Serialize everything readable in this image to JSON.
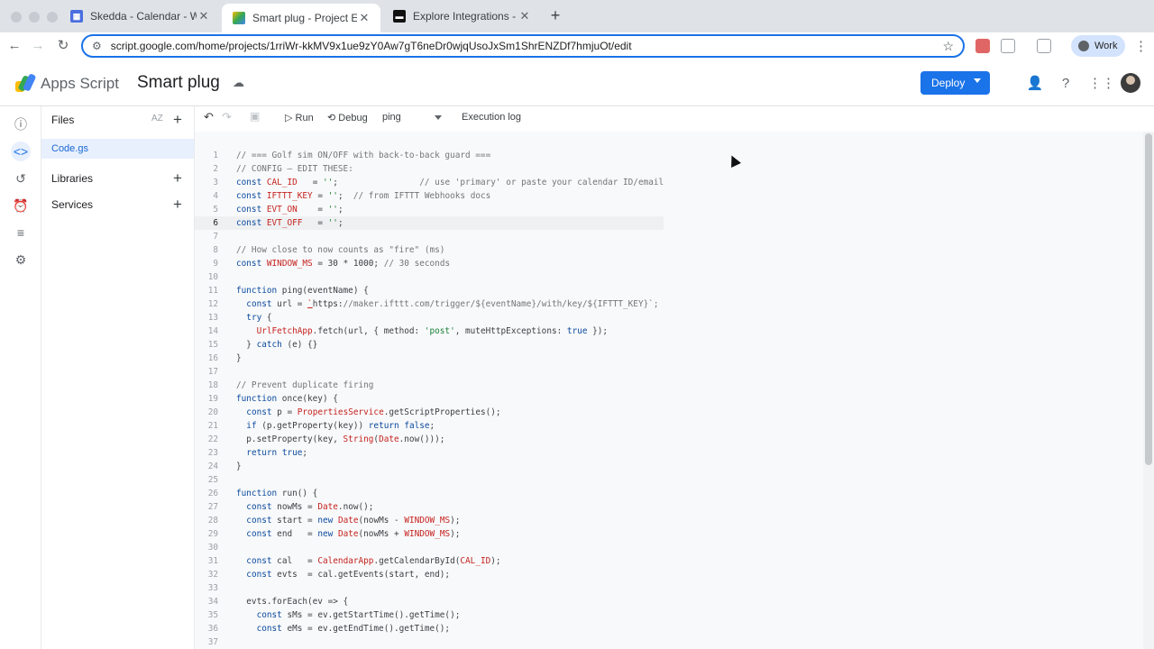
{
  "browser": {
    "tabs": [
      {
        "title": "Skedda - Calendar - Week of",
        "active": false
      },
      {
        "title": "Smart plug - Project Editor -",
        "active": true
      },
      {
        "title": "Explore Integrations - IFTTT",
        "active": false
      }
    ],
    "new_tab": "+",
    "url": "script.google.com/home/projects/1rriWr-kkMV9x1ue9zY0Aw7gT6neDr0wjqUsoJxSm1ShrENZDf7hmjuOt/edit",
    "profile_label": "Work"
  },
  "app": {
    "brand": "Apps Script",
    "project_title": "Smart plug",
    "deploy_label": "Deploy"
  },
  "files_panel": {
    "files_label": "Files",
    "sort_label": "AZ",
    "active_file": "Code.gs",
    "libraries_label": "Libraries",
    "services_label": "Services"
  },
  "editor_toolbar": {
    "run_label": "Run",
    "debug_label": "Debug",
    "function_select": "ping",
    "execution_log_label": "Execution log"
  },
  "code": {
    "current_line": 6,
    "lines": [
      "// === Golf sim ON/OFF with back-to-back guard ===",
      "// CONFIG — EDIT THESE:",
      "const CAL_ID   = '';                // use 'primary' or paste your calendar ID/email",
      "const IFTTT_KEY = '';  // from IFTTT Webhooks docs",
      "const EVT_ON    = '';",
      "const EVT_OFF   = '';",
      "",
      "// How close to now counts as \"fire\" (ms)",
      "const WINDOW_MS = 30 * 1000; // 30 seconds",
      "",
      "function ping(eventName) {",
      "  const url = `https://maker.ifttt.com/trigger/${eventName}/with/key/${IFTTT_KEY}`;",
      "  try {",
      "    UrlFetchApp.fetch(url, { method: 'post', muteHttpExceptions: true });",
      "  } catch (e) {}",
      "}",
      "",
      "// Prevent duplicate firing",
      "function once(key) {",
      "  const p = PropertiesService.getScriptProperties();",
      "  if (p.getProperty(key)) return false;",
      "  p.setProperty(key, String(Date.now()));",
      "  return true;",
      "}",
      "",
      "function run() {",
      "  const nowMs = Date.now();",
      "  const start = new Date(nowMs - WINDOW_MS);",
      "  const end   = new Date(nowMs + WINDOW_MS);",
      "",
      "  const cal   = CalendarApp.getCalendarById(CAL_ID);",
      "  const evts  = cal.getEvents(start, end);",
      "",
      "  evts.forEach(ev => {",
      "    const sMs = ev.getStartTime().getTime();",
      "    const eMs = ev.getEndTime().getTime();",
      ""
    ]
  },
  "colors": {
    "accent": "#1a73e8",
    "keyword": "#0b4a9e",
    "variable": "#c5221f",
    "string": "#188038",
    "comment": "#757575"
  }
}
